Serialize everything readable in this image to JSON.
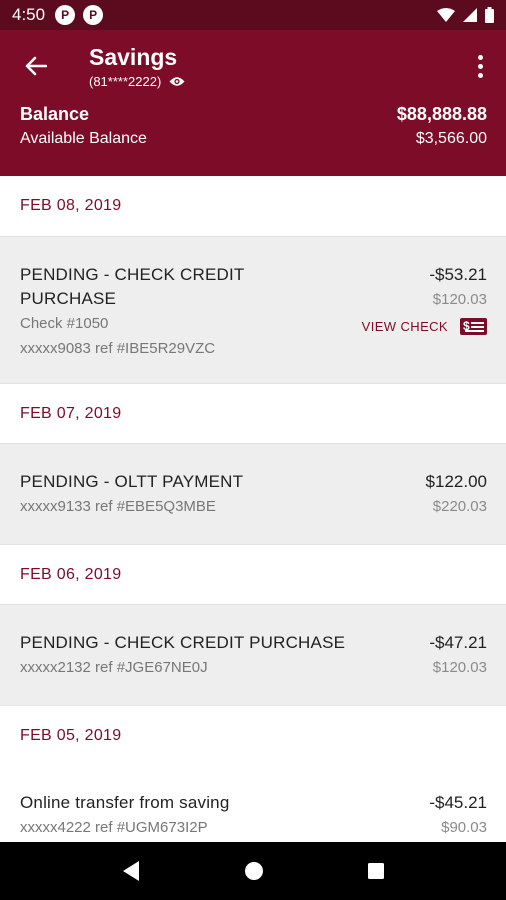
{
  "status_bar": {
    "time": "4:50",
    "badge1": "P",
    "badge2": "P"
  },
  "header": {
    "title": "Savings",
    "account_masked": "(81****2222)",
    "balance_label": "Balance",
    "balance_value": "$88,888.88",
    "available_label": "Available Balance",
    "available_value": "$3,566.00"
  },
  "groups": [
    {
      "date": "FEB 08, 2019",
      "transactions": [
        {
          "desc_line1": "PENDING - CHECK CREDIT",
          "desc_line2": "PURCHASE",
          "check_no": "Check #1050",
          "ref": "xxxxx9083 ref #IBE5R29VZC",
          "amount": "-$53.21",
          "balance": "$120.03",
          "view_check": "VIEW CHECK"
        }
      ]
    },
    {
      "date": "FEB 07, 2019",
      "transactions": [
        {
          "desc": "PENDING - OLTT PAYMENT",
          "ref": "xxxxx9133 ref #EBE5Q3MBE",
          "amount": "$122.00",
          "balance": "$220.03"
        }
      ]
    },
    {
      "date": "FEB 06, 2019",
      "transactions": [
        {
          "desc": "PENDING - CHECK CREDIT PURCHASE",
          "ref": "xxxxx2132 ref #JGE67NE0J",
          "amount": "-$47.21",
          "balance": "$120.03"
        }
      ]
    },
    {
      "date": "FEB 05, 2019",
      "transactions": [
        {
          "desc": "Online transfer from saving",
          "ref": "xxxxx4222 ref #UGM673I2P",
          "amount": "-$45.21",
          "balance": "$90.03"
        }
      ]
    }
  ],
  "colors": {
    "brand": "#7d0c28",
    "status_bar": "#5b0b1d",
    "row_bg": "#eeeeee"
  },
  "icons": [
    "back-arrow-icon",
    "eye-icon",
    "more-vert-icon",
    "check-icon",
    "nav-back-icon",
    "nav-home-icon",
    "nav-recents-icon",
    "wifi-icon",
    "signal-icon",
    "battery-icon"
  ]
}
